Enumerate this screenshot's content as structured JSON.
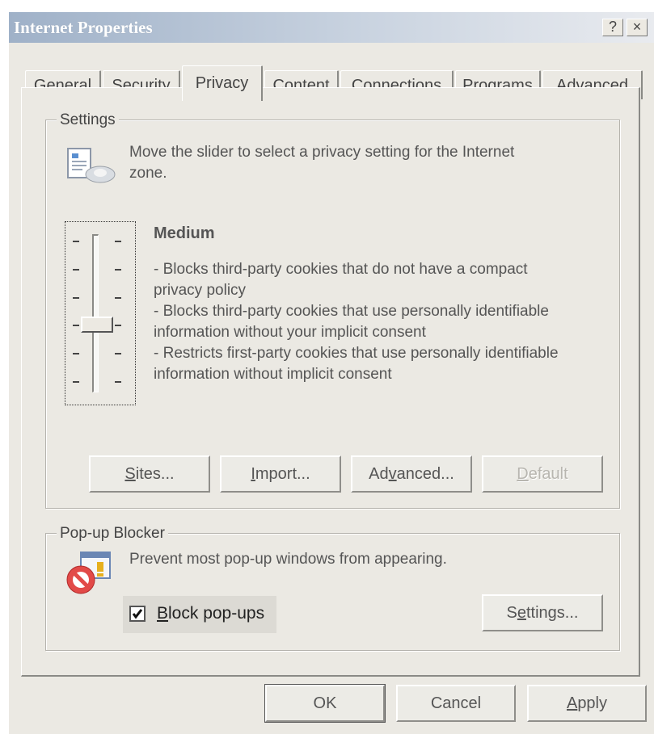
{
  "window": {
    "title": "Internet Properties",
    "help_button": "?",
    "close_button": "×"
  },
  "tabs": [
    {
      "label": "General",
      "active": false
    },
    {
      "label": "Security",
      "active": false
    },
    {
      "label": "Privacy",
      "active": true
    },
    {
      "label": "Content",
      "active": false
    },
    {
      "label": "Connections",
      "active": false
    },
    {
      "label": "Programs",
      "active": false
    },
    {
      "label": "Advanced",
      "active": false
    }
  ],
  "settings": {
    "legend": "Settings",
    "icon": "privacy-document-icon",
    "instruction_line1": "Move the slider to select a privacy setting for the Internet",
    "instruction_line2": "zone.",
    "slider": {
      "level_name": "Medium",
      "position_index": 3,
      "positions_total": 6
    },
    "description_lines": [
      "- Blocks third-party cookies that do not have a compact",
      "privacy policy",
      "- Blocks third-party cookies that use personally identifiable",
      "information without your implicit consent",
      "- Restricts first-party cookies that use personally identifiable",
      "information without implicit consent"
    ],
    "buttons": {
      "sites": {
        "pre": "",
        "ul": "S",
        "post": "ites..."
      },
      "import": {
        "pre": "",
        "ul": "I",
        "post": "mport..."
      },
      "advanced": {
        "pre": "Ad",
        "ul": "v",
        "post": "anced..."
      },
      "default": {
        "pre": "",
        "ul": "D",
        "post": "efault"
      }
    }
  },
  "popup_blocker": {
    "legend": "Pop-up Blocker",
    "icon": "popup-blocker-icon",
    "description": "Prevent most pop-up windows from appearing.",
    "checkbox": {
      "pre": "",
      "ul": "B",
      "post": "lock pop-ups",
      "checked": true
    },
    "settings_button": {
      "pre": "S",
      "ul": "e",
      "post": "ttings..."
    }
  },
  "footer": {
    "ok": "OK",
    "cancel": "Cancel",
    "apply": {
      "pre": "",
      "ul": "A",
      "post": "pply"
    }
  },
  "colors": {
    "dialog_bg": "#ebe9e3",
    "title_gradient_start": "#9fb1c8",
    "title_gradient_end": "#e9ebef",
    "disabled_text": "#b8b6b0",
    "no_sign_red": "#e24a48"
  }
}
